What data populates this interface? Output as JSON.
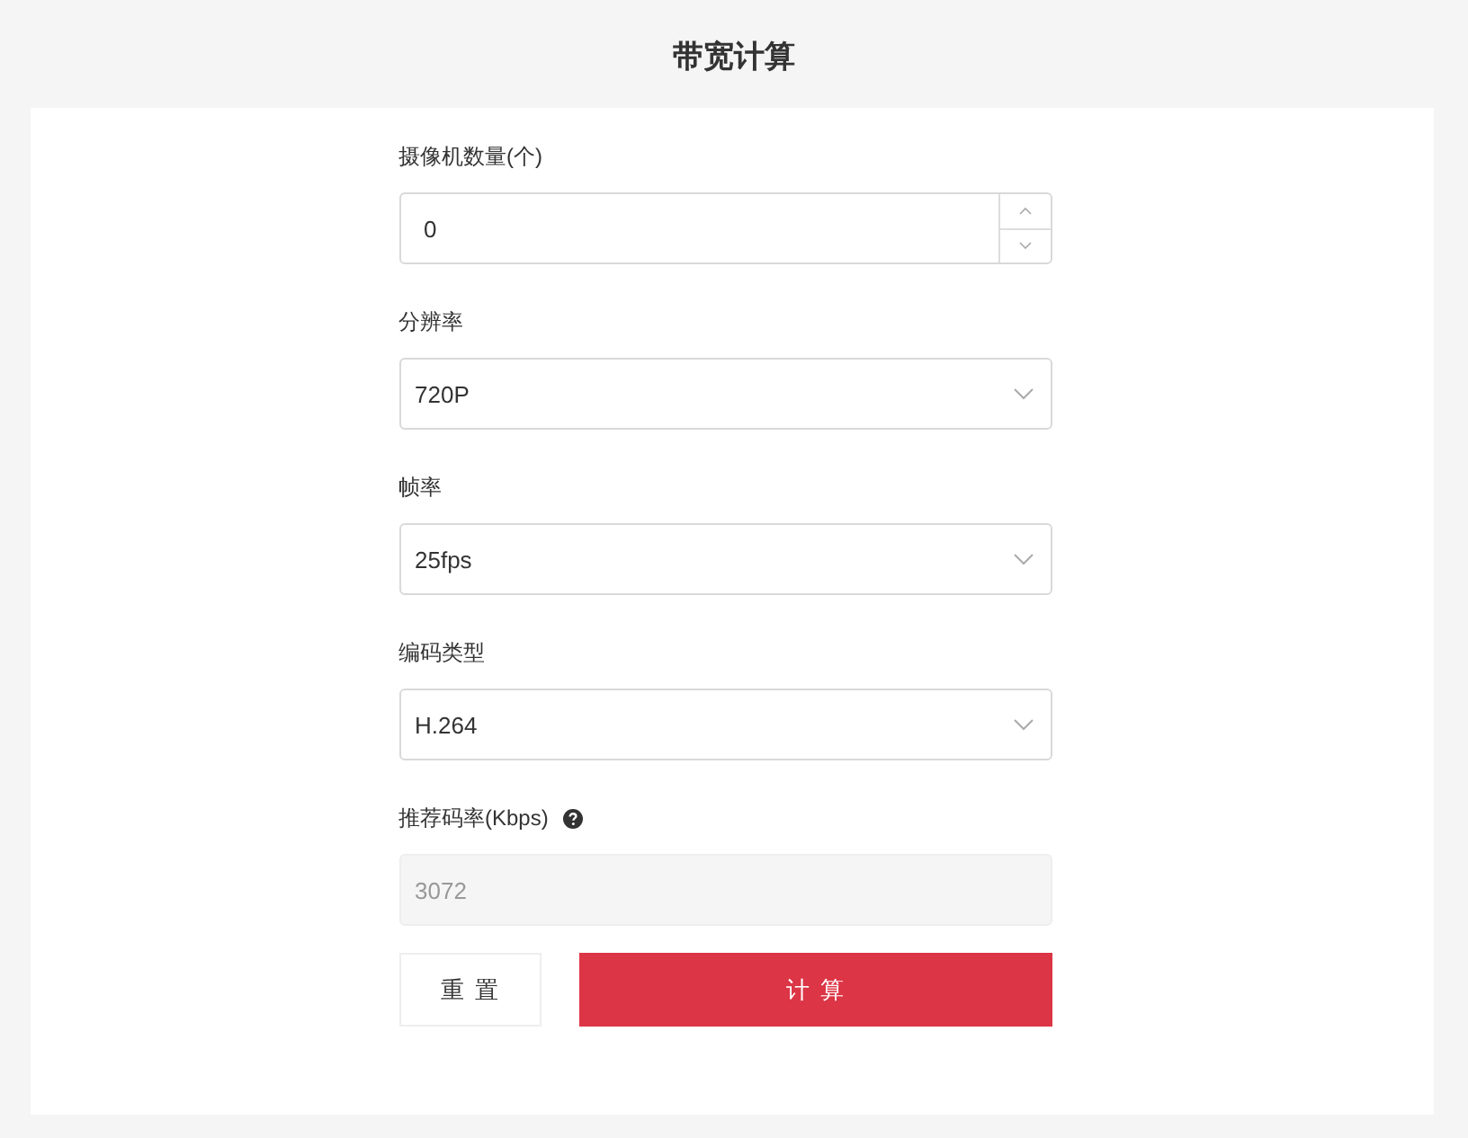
{
  "title": "带宽计算",
  "fields": [
    {
      "kind": "number",
      "label": "摄像机数量(个)",
      "value": "0"
    },
    {
      "kind": "select",
      "label": "分辨率",
      "value": "720P"
    },
    {
      "kind": "select",
      "label": "帧率",
      "value": "25fps"
    },
    {
      "kind": "select",
      "label": "编码类型",
      "value": "H.264"
    },
    {
      "kind": "readonly",
      "label": "推荐码率(Kbps)",
      "help": true,
      "value": "3072"
    }
  ],
  "buttons": [
    {
      "kind": "reset",
      "label": "重置"
    },
    {
      "kind": "primary",
      "label": "计算"
    }
  ]
}
